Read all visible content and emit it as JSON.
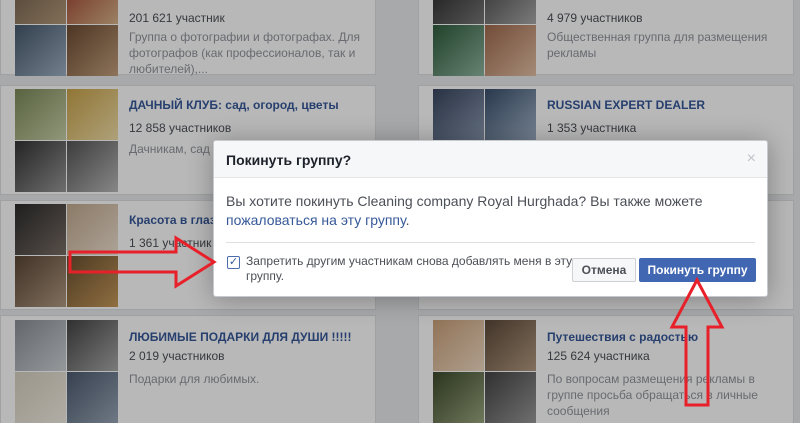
{
  "groups": [
    {
      "name": "",
      "count": "201 621 участник",
      "desc": "Группа о фотографии и фотографах. Для фотографов (как профессионалов, так и любителей),..."
    },
    {
      "name": "",
      "count": "4 979 участников",
      "desc": "Общественная группа для размещения рекламы"
    },
    {
      "name": "ДАЧНЫЙ КЛУБ: сад, огород, цветы",
      "count": "12 858 участников",
      "desc": "Дачникам, сад"
    },
    {
      "name": "RUSSIAN EXPERT DEALER",
      "count": "1 353 участника",
      "desc": ""
    },
    {
      "name": "Красота в глаз",
      "count": "1 361 участник",
      "desc": ""
    },
    {
      "name": "ЛЮБИМЫЕ ПОДАРКИ ДЛЯ ДУШИ !!!!!",
      "count": "2 019 участников",
      "desc": "Подарки для любимых."
    },
    {
      "name": "Путешествия с радостью",
      "count": "125 624 участника",
      "desc": "По вопросам размещения рекламы в группе просьба обращаться в личные сообщения"
    }
  ],
  "dialog": {
    "title": "Покинуть группу?",
    "close": "×",
    "body_text": "Вы хотите покинуть Cleaning company Royal Hurghada? Вы также можете ",
    "body_link": "пожаловаться на эту группу",
    "body_end": ".",
    "checkbox_label": "Запретить другим участникам снова добавлять меня в эту группу.",
    "checkbox_mark": "✓",
    "checked": true,
    "cancel_label": "Отмена",
    "leave_label": "Покинуть группу"
  },
  "colors": {
    "accent": "#4267b2",
    "link": "#365899",
    "annotation": "#e8202a"
  }
}
